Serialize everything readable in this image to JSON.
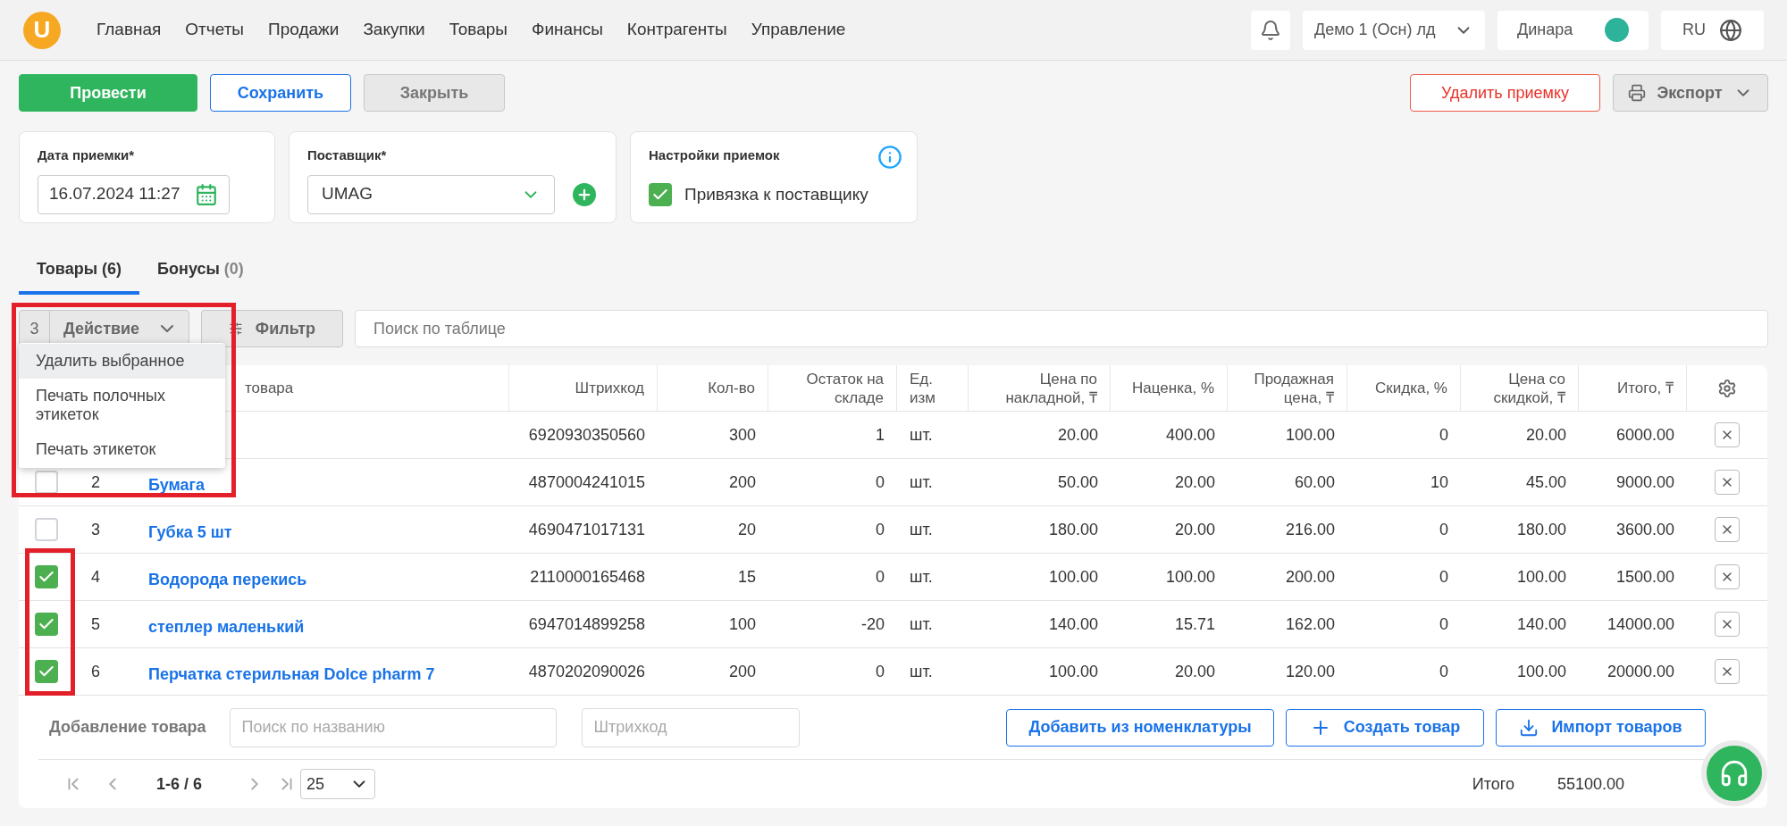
{
  "logo": "U",
  "nav": [
    "Главная",
    "Отчеты",
    "Продажи",
    "Закупки",
    "Товары",
    "Финансы",
    "Контрагенты",
    "Управление"
  ],
  "header": {
    "store": "Демо 1 (Осн) лд",
    "user": "Динара",
    "language": "RU"
  },
  "actions": [
    {
      "label": "Провести",
      "kind": "primary"
    },
    {
      "label": "Сохранить",
      "kind": "outline"
    },
    {
      "label": "Закрыть",
      "kind": "muted"
    }
  ],
  "delete_button": "Удалить приемку",
  "export_button": "Экспорт",
  "date_card": {
    "label": "Дата приемки*",
    "value": "16.07.2024 11:27"
  },
  "supplier_card": {
    "label": "Поставщик*",
    "value": "UMAG"
  },
  "settings_card": {
    "title": "Настройки приемок",
    "option": {
      "label": "Привязка к поставщику",
      "checked": true
    }
  },
  "tabs": [
    {
      "label": "Товары",
      "count": "(6)",
      "selected": true
    },
    {
      "label": "Бонусы",
      "count": "(0)",
      "selected": false
    }
  ],
  "toolbar": {
    "selected_count": "3",
    "action": "Действие",
    "filter": "Фильтр",
    "search_placeholder": "Поиск по таблице"
  },
  "action_menu": [
    {
      "label": "Удалить выбранное",
      "selected": true
    },
    {
      "label": "Печать полочных этикеток",
      "selected": false
    },
    {
      "label": "Печать этикеток",
      "selected": false
    }
  ],
  "table": {
    "columns": [
      "товара",
      "Штрихкод",
      "Кол-во",
      "Остаток на складе",
      "Ед. изм",
      "Цена по накладной, ₸",
      "Наценка, %",
      "Продажная цена, ₸",
      "Скидка, %",
      "Цена со скидкой, ₸",
      "Итого, ₸"
    ],
    "rows": [
      {
        "cells": [
          "",
          "6920930350560",
          "300",
          "1",
          "шт.",
          "20.00",
          "400.00",
          "100.00",
          "0",
          "20.00",
          "6000.00"
        ]
      },
      {
        "number": "2",
        "checked": false,
        "cells": [
          "Бумага",
          "4870004241015",
          "200",
          "0",
          "шт.",
          "50.00",
          "20.00",
          "60.00",
          "10",
          "45.00",
          "9000.00"
        ]
      },
      {
        "number": "3",
        "checked": false,
        "cells": [
          "Губка 5 шт",
          "4690471017131",
          "20",
          "0",
          "шт.",
          "180.00",
          "20.00",
          "216.00",
          "0",
          "180.00",
          "3600.00"
        ]
      },
      {
        "number": "4",
        "checked": true,
        "cells": [
          "Водорода перекись",
          "2110000165468",
          "15",
          "0",
          "шт.",
          "100.00",
          "100.00",
          "200.00",
          "0",
          "100.00",
          "1500.00"
        ]
      },
      {
        "number": "5",
        "checked": true,
        "cells": [
          "степлер маленький",
          "6947014899258",
          "100",
          "-20",
          "шт.",
          "140.00",
          "15.71",
          "162.00",
          "0",
          "140.00",
          "14000.00"
        ]
      },
      {
        "number": "6",
        "checked": true,
        "cells": [
          "Перчатка стерильная Dolce pharm 7",
          "4870202090026",
          "200",
          "0",
          "шт.",
          "100.00",
          "20.00",
          "120.00",
          "0",
          "100.00",
          "20000.00"
        ]
      }
    ]
  },
  "add_row": {
    "label": "Добавление товара",
    "name_placeholder": "Поиск по названию",
    "barcode_placeholder": "Штрихкод",
    "buttons": [
      {
        "label": "Добавить из номенклатуры",
        "kind": "plain"
      },
      {
        "label": "Создать товар",
        "kind": "create"
      },
      {
        "label": "Импорт товаров",
        "kind": "import"
      }
    ]
  },
  "pagination": {
    "range": "1-6 / 6",
    "page_size": "25"
  },
  "total": {
    "label": "Итого",
    "value": "55100.00"
  }
}
